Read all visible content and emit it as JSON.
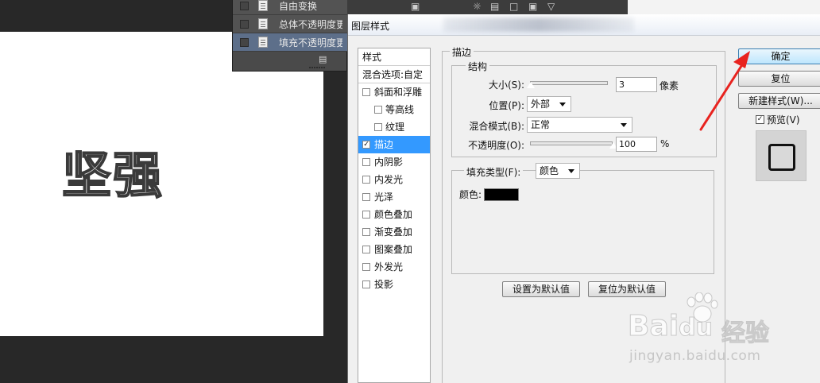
{
  "canvas": {
    "text": "坚强"
  },
  "layers": {
    "items": [
      {
        "label": "自由变换"
      },
      {
        "label": "总体不透明度更改"
      },
      {
        "label": "填充不透明度更改"
      }
    ]
  },
  "dialog": {
    "title": "图层样式",
    "styles_header": "样式",
    "blend_options": "混合选项:自定",
    "styles": [
      {
        "label": "斜面和浮雕",
        "checked": false
      },
      {
        "label": "等高线",
        "checked": false
      },
      {
        "label": "纹理",
        "checked": false
      },
      {
        "label": "描边",
        "checked": true
      },
      {
        "label": "内阴影",
        "checked": false
      },
      {
        "label": "内发光",
        "checked": false
      },
      {
        "label": "光泽",
        "checked": false
      },
      {
        "label": "颜色叠加",
        "checked": false
      },
      {
        "label": "渐变叠加",
        "checked": false
      },
      {
        "label": "图案叠加",
        "checked": false
      },
      {
        "label": "外发光",
        "checked": false
      },
      {
        "label": "投影",
        "checked": false
      }
    ],
    "stroke": {
      "section_title": "描边",
      "structure_title": "结构",
      "size_label": "大小(S):",
      "size_value": "3",
      "size_unit": "像素",
      "size_level": 0.0,
      "position_label": "位置(P):",
      "position_value": "外部",
      "blend_mode_label": "混合模式(B):",
      "blend_mode_value": "正常",
      "opacity_label": "不透明度(O):",
      "opacity_value": "100",
      "opacity_unit": "%",
      "opacity_level": 1.0,
      "fill_type_label": "填充类型(F):",
      "fill_type_value": "颜色",
      "color_label": "颜色:",
      "color_value": "#000000"
    },
    "buttons": {
      "make_default": "设置为默认值",
      "reset_default": "复位为默认值",
      "ok": "确定",
      "reset": "复位",
      "new_style": "新建样式(W)...",
      "preview_label": "预览(V)"
    },
    "preview_checked": true
  },
  "watermark": {
    "brand": "Bai",
    "brand_tail": "du",
    "jingyan": "经验",
    "url": "jingyan.baidu.com"
  },
  "colors": {
    "selection": "#3399ff",
    "annotation_arrow": "#e8231f"
  }
}
